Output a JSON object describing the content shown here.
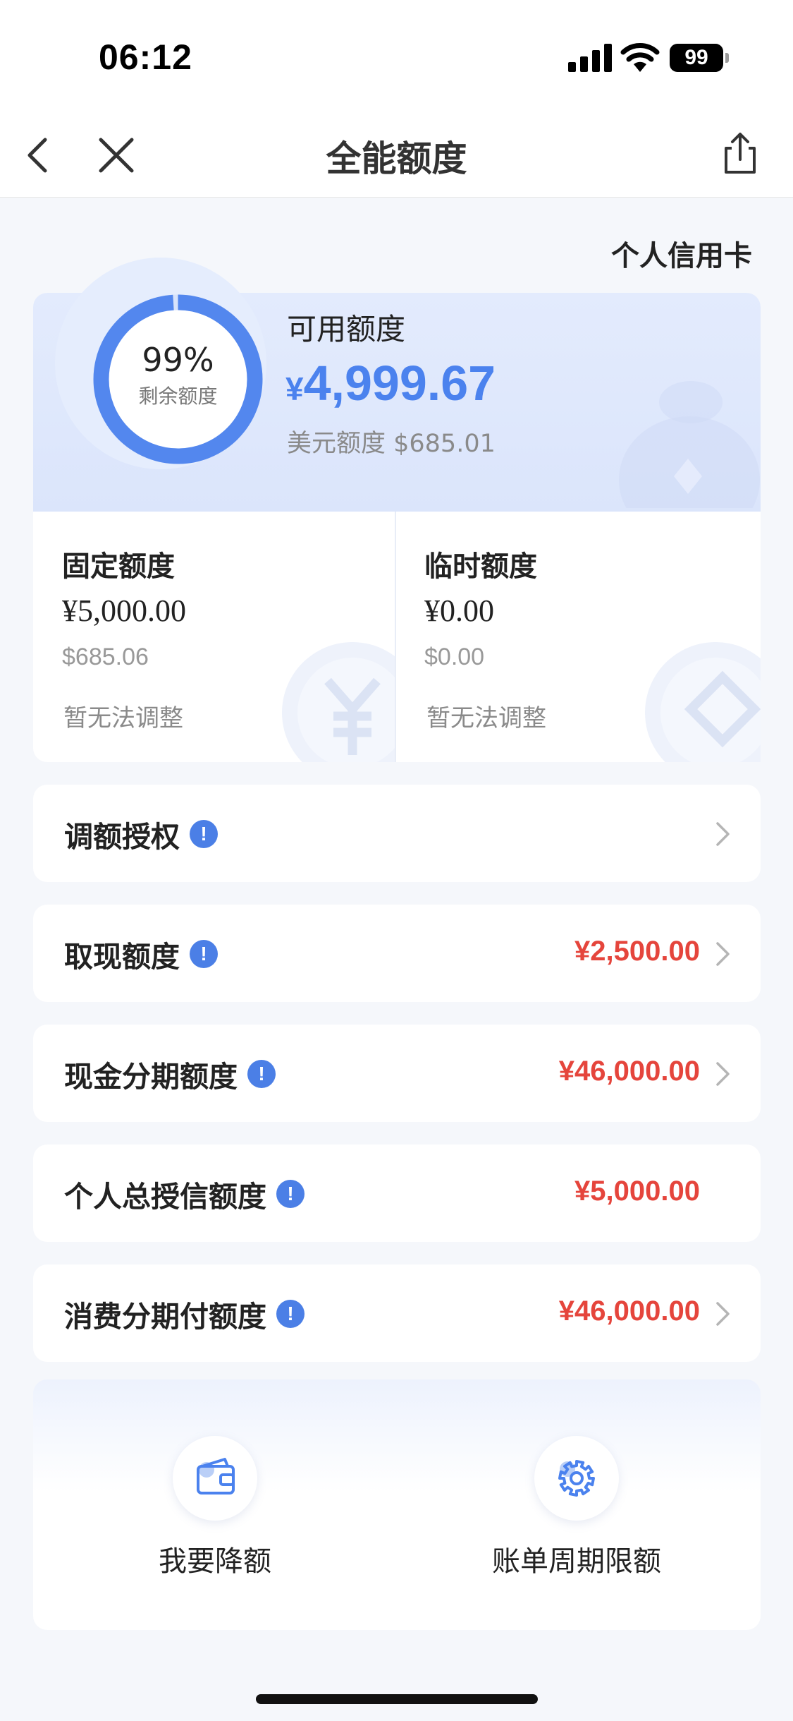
{
  "status_bar": {
    "time": "06:12",
    "battery": "99"
  },
  "nav": {
    "title": "全能额度",
    "back_icon": "chevron-left-icon",
    "close_icon": "close-icon",
    "share_icon": "share-icon"
  },
  "card_type": "个人信用卡",
  "summary": {
    "remaining_percent": "99%",
    "remaining_fraction": 0.99,
    "remaining_label": "剩余额度",
    "available_label": "可用额度",
    "available_currency": "¥",
    "available_value": "4,999.67",
    "usd_text": "美元额度 $685.01"
  },
  "fixed": {
    "title": "固定额度",
    "amount": "¥5,000.00",
    "usd": "$685.06",
    "note": "暂无法调整"
  },
  "temporary": {
    "title": "临时额度",
    "amount": "¥0.00",
    "usd": "$0.00",
    "note": "暂无法调整"
  },
  "rows": [
    {
      "label": "调额授权",
      "value": ""
    },
    {
      "label": "取现额度",
      "value": "¥2,500.00"
    },
    {
      "label": "现金分期额度",
      "value": "¥46,000.00"
    },
    {
      "label": "个人总授信额度",
      "value": "¥5,000.00"
    },
    {
      "label": "消费分期付额度",
      "value": "¥46,000.00"
    }
  ],
  "info_glyph": "!",
  "actions": [
    {
      "label": "我要降额",
      "icon": "wallet-icon"
    },
    {
      "label": "账单周期限额",
      "icon": "gear-icon"
    }
  ],
  "colors": {
    "accent": "#4b82ee",
    "amount_red": "#e5453c",
    "background": "#f5f7fb"
  }
}
